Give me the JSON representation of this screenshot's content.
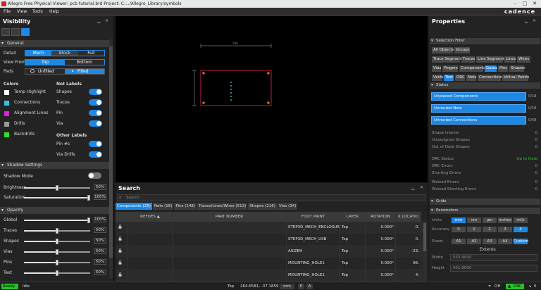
{
  "window": {
    "title": "Allegro Free Physical Viewer: pcb tutorial.brd  Project: C:.../Allegro_Library/symbols",
    "brand": "cadence"
  },
  "menu": [
    "File",
    "View",
    "Tools",
    "Help"
  ],
  "visibility": {
    "title": "Visibility",
    "general": "General",
    "detail_label": "Detail",
    "detail_options": [
      "Mech",
      "Block",
      "Full"
    ],
    "view_from_label": "View From",
    "view_from_options": [
      "Top",
      "Bottom"
    ],
    "pads_label": "Pads",
    "pads_options": [
      "Unfilled",
      "Filled"
    ],
    "colors_header": "Colors",
    "colors": [
      {
        "label": "Temp Highlight",
        "color": "#ffffff"
      },
      {
        "label": "Connections",
        "color": "#2ec4e8"
      },
      {
        "label": "Alignment Lines",
        "color": "#e020e0"
      },
      {
        "label": "Drills",
        "color": "#9a9a9a"
      },
      {
        "label": "Backdrills",
        "color": "#30e030"
      }
    ],
    "net_labels_header": "Net Labels",
    "net_labels": [
      "Shapes",
      "Traces",
      "Pin",
      "Via"
    ],
    "other_labels_header": "Other Labels",
    "other_labels": [
      "Pin #s",
      "Via Drills"
    ],
    "shadow_settings": "Shadow Settings",
    "shadow_mode": "Shadow Mode",
    "brightness": {
      "label": "Brightness",
      "value": "50%",
      "level": 0.5
    },
    "saturation": {
      "label": "Saturation",
      "value": "100%",
      "level": 1.0
    },
    "opacity": "Opacity",
    "opacity_items": [
      {
        "label": "Global",
        "value": "100%",
        "level": 1.0
      },
      {
        "label": "Traces",
        "value": "50%",
        "level": 0.5
      },
      {
        "label": "Shapes",
        "value": "50%",
        "level": 0.5
      },
      {
        "label": "Vias",
        "value": "50%",
        "level": 0.5
      },
      {
        "label": "Pins",
        "value": "50%",
        "level": 0.5
      },
      {
        "label": "Text",
        "value": "50%",
        "level": 0.5
      }
    ]
  },
  "search": {
    "title": "Search",
    "placeholder": "Search",
    "tabs": [
      "Components (25)",
      "Nets (18)",
      "Pins (148)",
      "Traces/Lines/Wires (513)",
      "Shapes (216)",
      "Vias (34)"
    ],
    "columns": [
      "REFDES",
      "PART NUMBER",
      "FOOT PRINT",
      "LAYER",
      "ROTATION",
      "X LOCATIO"
    ],
    "rows": [
      {
        "refdes": "",
        "part": "",
        "footprint": "STEP3D_MECH_ENCLOSURE",
        "layer": "Top",
        "rotation": "0.000°",
        "x": "0."
      },
      {
        "refdes": "",
        "part": "",
        "footprint": "STEP3D_MECH_USB",
        "layer": "Top",
        "rotation": "0.000°",
        "x": "0."
      },
      {
        "refdes": "",
        "part": "",
        "footprint": "ASIZEH",
        "layer": "Top",
        "rotation": "0.000°",
        "x": "-23."
      },
      {
        "refdes": "",
        "part": "",
        "footprint": "MOUNTING_HOLE1",
        "layer": "Top",
        "rotation": "0.000°",
        "x": "96."
      },
      {
        "refdes": "",
        "part": "",
        "footprint": "MOUNTING_HOLE1",
        "layer": "Top",
        "rotation": "0.000°",
        "x": "4."
      }
    ]
  },
  "properties": {
    "title": "Properties",
    "selection_filter": "Selection Filter",
    "filters": [
      [
        {
          "t": "All Objects",
          "on": false
        },
        {
          "t": "Groups",
          "on": false
        }
      ],
      [
        {
          "t": "Trace Segments",
          "on": false
        },
        {
          "t": "Traces",
          "on": false
        },
        {
          "t": "Line Segments",
          "on": false
        },
        {
          "t": "Lines",
          "on": false
        },
        {
          "t": "Wires",
          "on": false
        }
      ],
      [
        {
          "t": "Vias",
          "on": false
        },
        {
          "t": "Fingers",
          "on": false
        },
        {
          "t": "Components",
          "on": false
        },
        {
          "t": "Gates",
          "on": true
        },
        {
          "t": "Pins",
          "on": false
        },
        {
          "t": "Shapes",
          "on": false
        }
      ],
      [
        {
          "t": "Voids",
          "on": false
        },
        {
          "t": "Text",
          "on": true
        },
        {
          "t": "DRC",
          "on": false
        },
        {
          "t": "Nets",
          "on": false
        },
        {
          "t": "Connections",
          "on": false
        },
        {
          "t": "Virtual Points",
          "on": false
        }
      ]
    ],
    "status": "Status",
    "status_bars": [
      {
        "label": "Unplaced Components",
        "count": "0/18"
      },
      {
        "label": "Unrouted Nets",
        "count": "0/18"
      },
      {
        "label": "Unrouted Connections",
        "count": "0/59"
      }
    ],
    "stats1": [
      {
        "k": "Shape Islands",
        "v": "0"
      },
      {
        "k": "Unassigned Shapes",
        "v": "0"
      },
      {
        "k": "Out of Date Shapes",
        "v": "0"
      }
    ],
    "stats2": [
      {
        "k": "DRC Status",
        "v": "Up to Date"
      },
      {
        "k": "DRC Errors",
        "v": "0"
      },
      {
        "k": "Shorting Errors",
        "v": "0"
      }
    ],
    "stats3": [
      {
        "k": "Waived Errors",
        "v": "0"
      },
      {
        "k": "Waived Shorting Errors",
        "v": "0"
      }
    ],
    "grids": "Grids",
    "parameters": "Parameters",
    "units_label": "Units",
    "units": [
      "mm",
      "cm",
      "μm",
      "inches",
      "mils"
    ],
    "accuracy_label": "Accuracy",
    "accuracy": [
      "0",
      "1",
      "2",
      "3",
      "4"
    ],
    "sheet_label": "Sheet",
    "sheet": [
      "A1",
      "A2",
      "A3",
      "A4",
      "Custom"
    ],
    "extents": "Extents",
    "width_label": "Width",
    "width_value": "533.4000",
    "height_label": "Height",
    "height_value": "431.8000"
  },
  "statusbar": {
    "ready": "Ready",
    "idle": "Idle",
    "layer": "Top",
    "coords": "264.6581, -37.1859",
    "unit": "mm",
    "btn_p": "P",
    "btn_a": "A",
    "off": "Off",
    "drc": "DRC",
    "count": "0"
  },
  "colors": {
    "accent": "#1e88e5",
    "board_outline": "#c01850",
    "pad": "#d4882a",
    "ready_bg": "#28c228"
  }
}
